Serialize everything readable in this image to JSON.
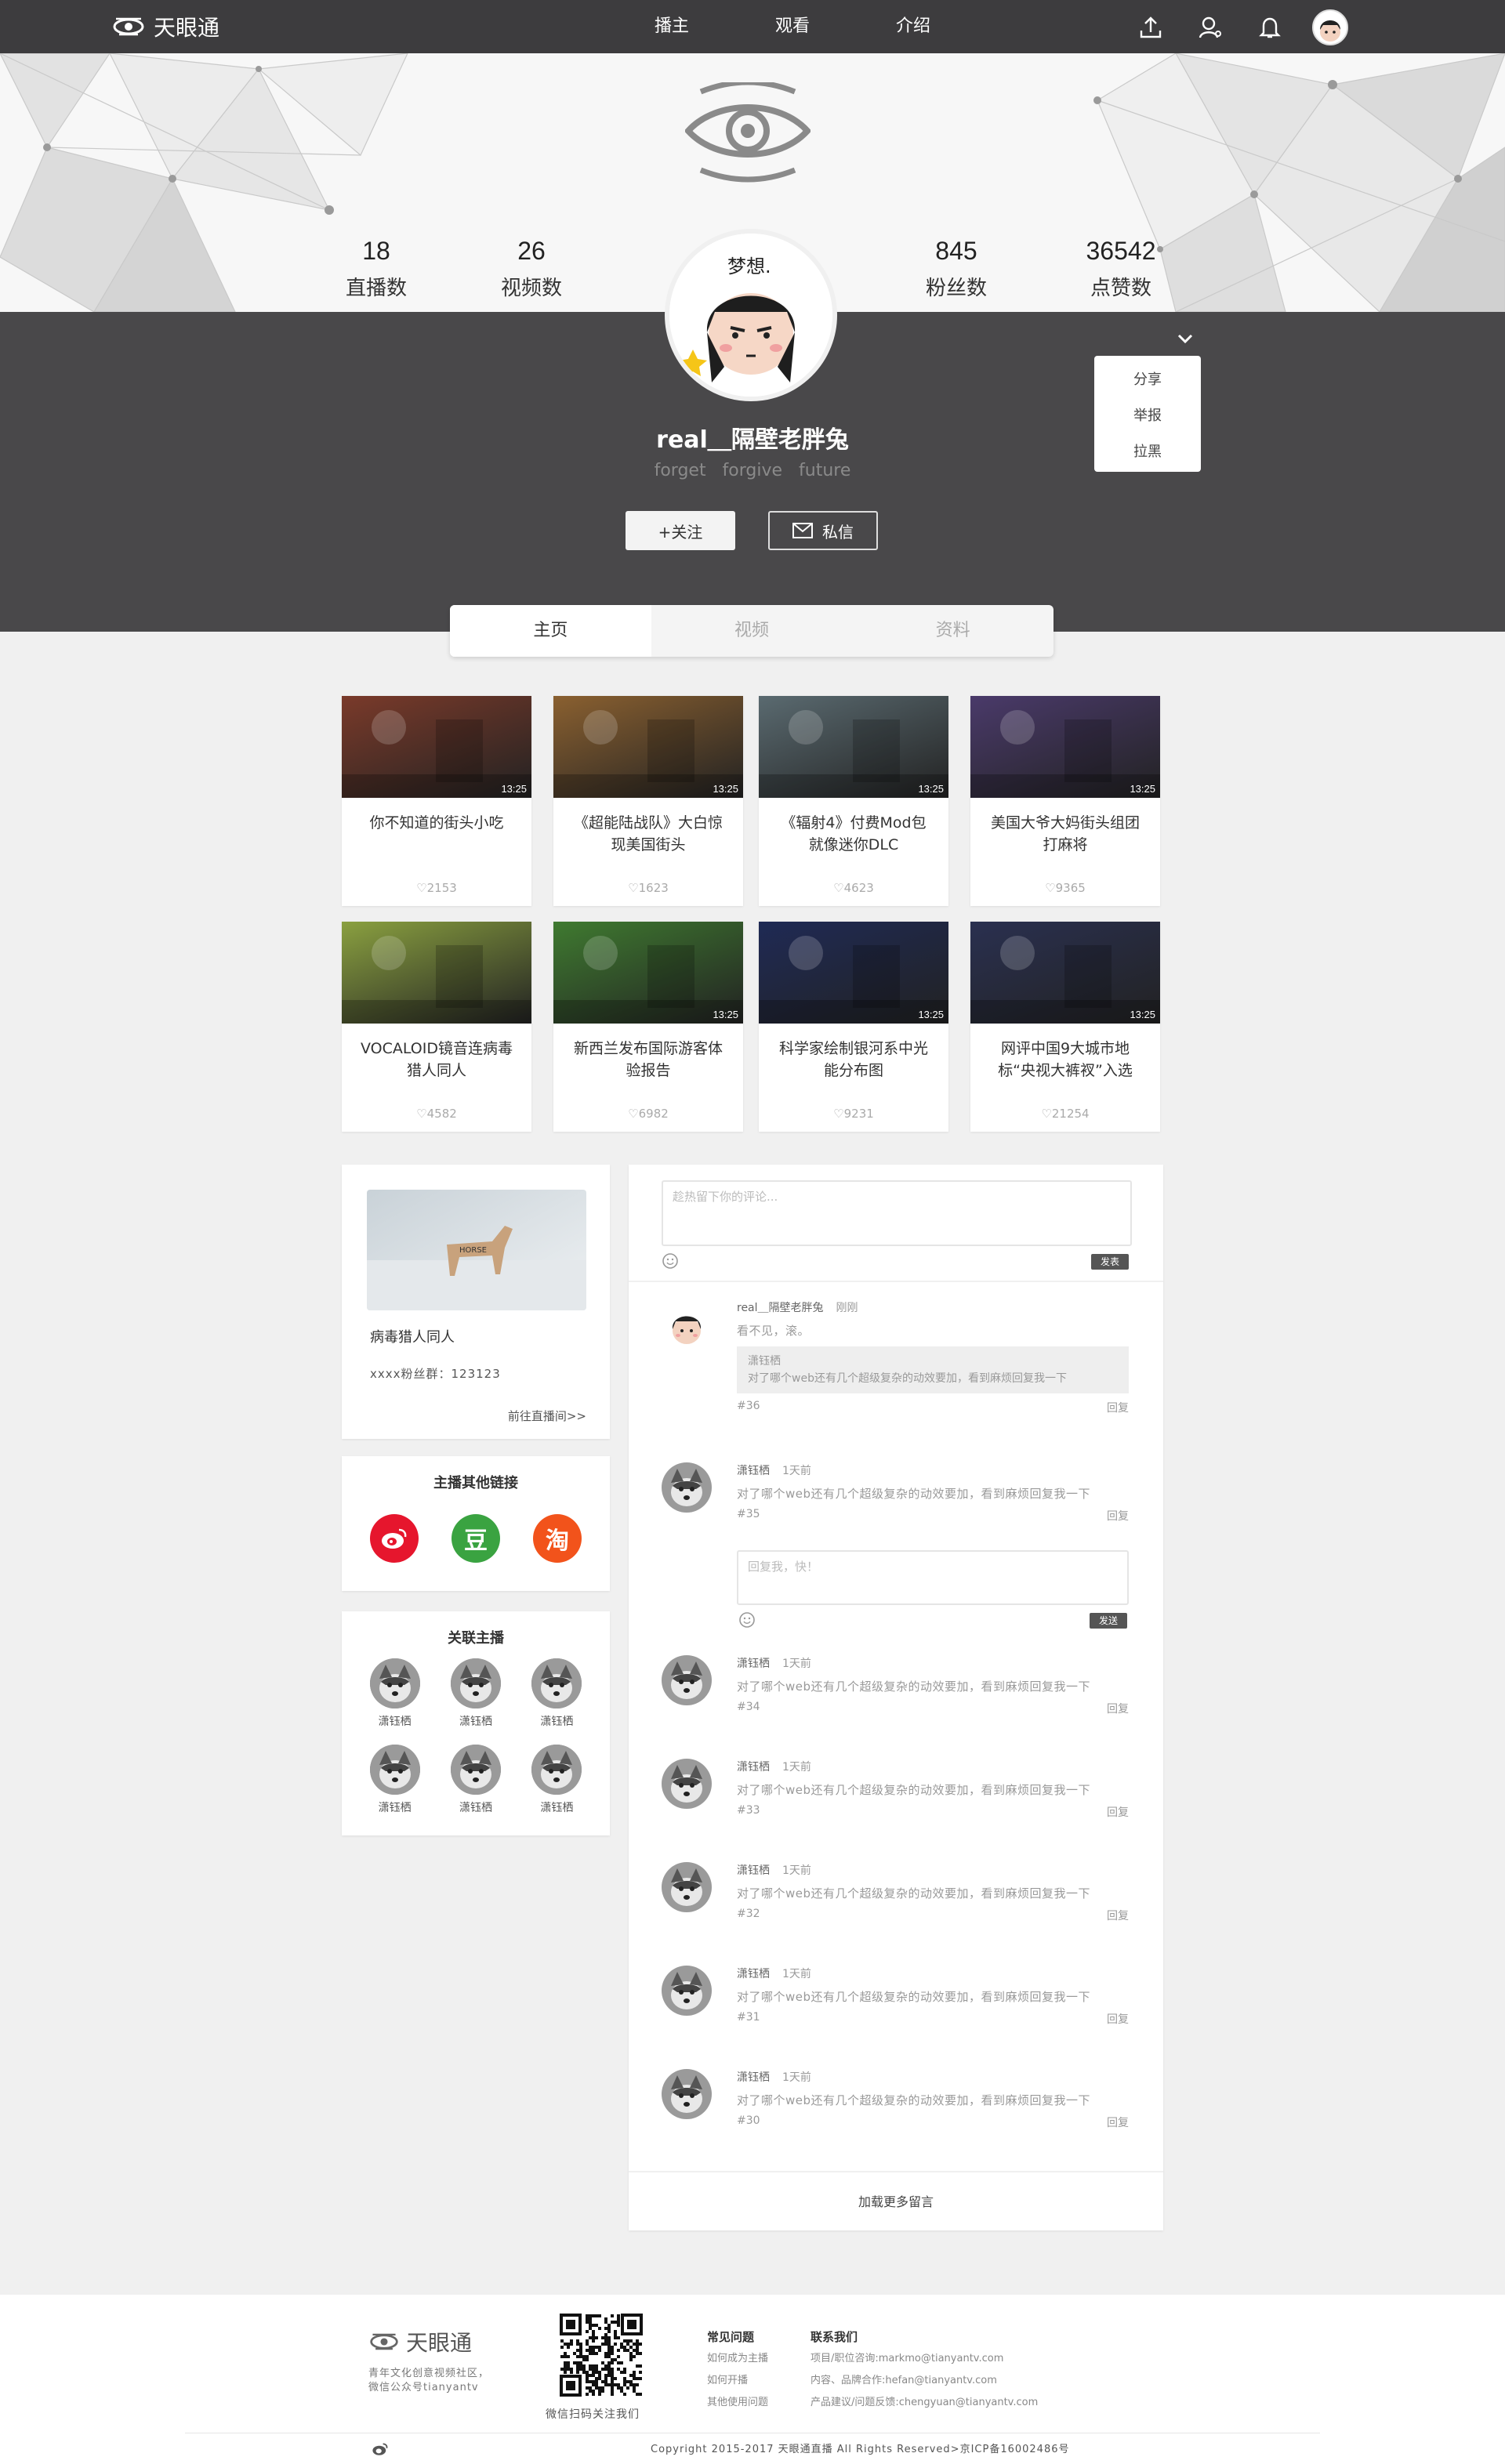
{
  "nav": {
    "logo_text": "天眼通",
    "links": [
      "播主",
      "观看",
      "介绍"
    ]
  },
  "profile": {
    "stats": [
      {
        "num": "18",
        "label": "直播数"
      },
      {
        "num": "26",
        "label": "视频数"
      },
      {
        "num": "845",
        "label": "粉丝数"
      },
      {
        "num": "36542",
        "label": "点赞数"
      }
    ],
    "avatar_caption": "梦想.",
    "username": "real＿隔壁老胖兔",
    "motto": "forget forgive future",
    "follow_label": "+关注",
    "message_label": "私信",
    "menu": [
      "分享",
      "举报",
      "拉黑"
    ]
  },
  "tabs": [
    "主页",
    "视频",
    "资料"
  ],
  "videos": [
    {
      "title": "你不知道的街头小吃",
      "duration": "13:25",
      "likes": "2153",
      "color": "#7a3a2a"
    },
    {
      "title": "《超能陆战队》大白惊现美国街头",
      "duration": "13:25",
      "likes": "1623",
      "color": "#8a6030"
    },
    {
      "title": "《辐射4》付费Mod包就像迷你DLC",
      "duration": "13:25",
      "likes": "4623",
      "color": "#5a6a70"
    },
    {
      "title": "美国大爷大妈街头组团打麻将",
      "duration": "13:25",
      "likes": "9365",
      "color": "#4a3a6a"
    },
    {
      "title": "VOCALOID镜音连病毒猎人同人",
      "duration": "",
      "likes": "4582",
      "color": "#8aa040"
    },
    {
      "title": "新西兰发布国际游客体验报告",
      "duration": "13:25",
      "likes": "6982",
      "color": "#3f7a30"
    },
    {
      "title": "科学家绘制银河系中光能分布图",
      "duration": "13:25",
      "likes": "9231",
      "color": "#1f2a55"
    },
    {
      "title": "网评中国9大城市地标“央视大裤衩”入选",
      "duration": "13:25",
      "likes": "21254",
      "color": "#2a3050"
    }
  ],
  "host": {
    "name": "病毒猎人同人",
    "group": "xxxx粉丝群：123123",
    "link": "前往直播间>>"
  },
  "other_links": {
    "title": "主播其他链接",
    "items": [
      {
        "name": "weibo",
        "glyph": "◉",
        "color": "#e6162d"
      },
      {
        "name": "douban",
        "glyph": "豆",
        "color": "#3aa341"
      },
      {
        "name": "taobao",
        "glyph": "淘",
        "color": "#f2531b"
      }
    ]
  },
  "related": {
    "title": "关联主播",
    "names": [
      "潇钰栖",
      "潇钰栖",
      "潇钰栖",
      "潇钰栖",
      "潇钰栖",
      "潇钰栖"
    ]
  },
  "comments": {
    "placeholder": "趁热留下你的评论...",
    "send_label": "发表",
    "reply_placeholder": "回复我，快！",
    "reply_send_label": "发送",
    "reply_label": "回复",
    "load_more": "加载更多留言",
    "items": [
      {
        "name": "real＿隔壁老胖兔",
        "time": "刚刚",
        "text": "看不见，滚。",
        "quote_name": "潇钰栖",
        "quote_text": "对了哪个web还有几个超级复杂的动效要加，看到麻烦回复我一下",
        "num": "#36"
      },
      {
        "name": "潇钰栖",
        "time": "1天前",
        "text": "对了哪个web还有几个超级复杂的动效要加，看到麻烦回复我一下",
        "num": "#35"
      },
      {
        "name": "潇钰栖",
        "time": "1天前",
        "text": "对了哪个web还有几个超级复杂的动效要加，看到麻烦回复我一下",
        "num": "#34"
      },
      {
        "name": "潇钰栖",
        "time": "1天前",
        "text": "对了哪个web还有几个超级复杂的动效要加，看到麻烦回复我一下",
        "num": "#33"
      },
      {
        "name": "潇钰栖",
        "time": "1天前",
        "text": "对了哪个web还有几个超级复杂的动效要加，看到麻烦回复我一下",
        "num": "#32"
      },
      {
        "name": "潇钰栖",
        "time": "1天前",
        "text": "对了哪个web还有几个超级复杂的动效要加，看到麻烦回复我一下",
        "num": "#31"
      },
      {
        "name": "潇钰栖",
        "time": "1天前",
        "text": "对了哪个web还有几个超级复杂的动效要加，看到麻烦回复我一下",
        "num": "#30"
      }
    ]
  },
  "footer": {
    "logo_text": "天眼通",
    "desc_line1": "青年文化创意视频社区，",
    "desc_line2": "微信公众号tianyantv",
    "qr_caption": "微信扫码关注我们",
    "faq_title": "常见问题",
    "faq": [
      "如何成为主播",
      "如何开播",
      "其他使用问题"
    ],
    "contact_title": "联系我们",
    "contact": [
      "项目/职位咨询:markmo@tianyantv.com",
      "内容、品牌合作:hefan@tianyantv.com",
      "产品建议/问题反馈:chengyuan@tianyantv.com"
    ],
    "copyright": "Copyright  2015-2017 天眼通直播 All Rights Reserved>京ICP备16002486号"
  }
}
